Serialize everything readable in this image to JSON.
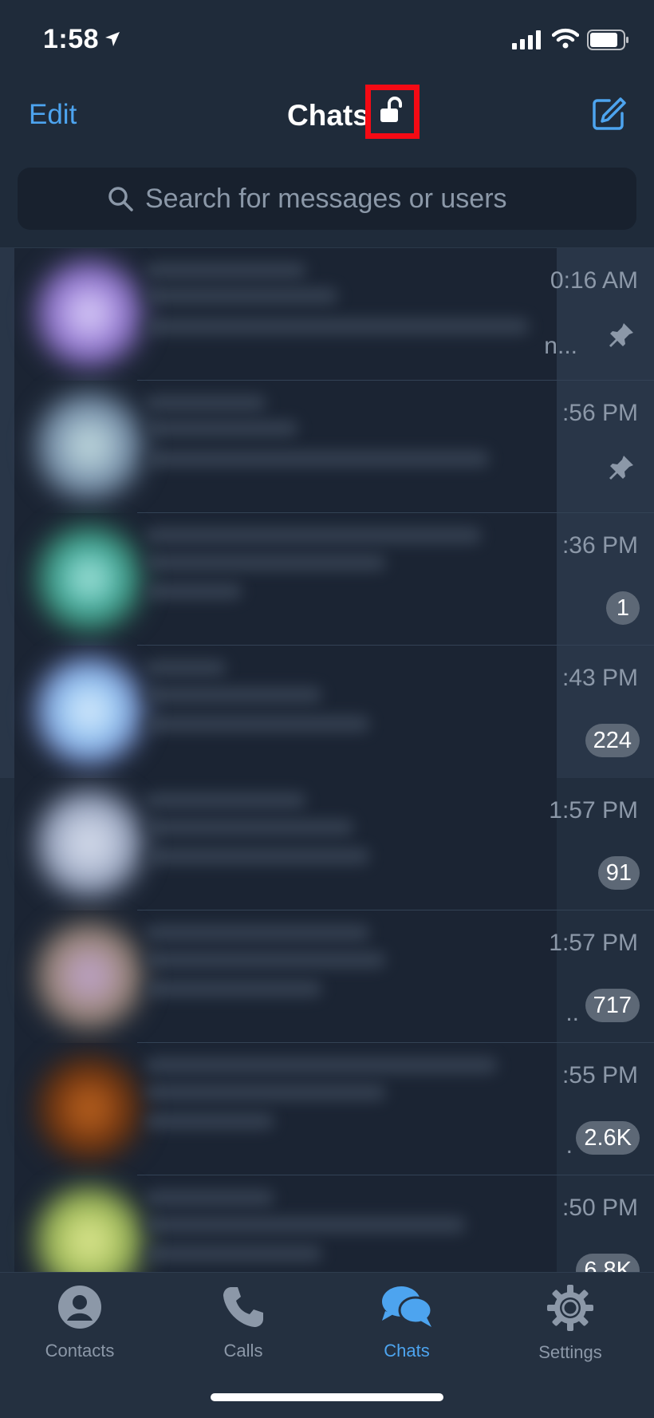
{
  "status_bar": {
    "time": "1:58",
    "icons": [
      "location-arrow-icon",
      "cellular-signal-icon",
      "wifi-icon",
      "battery-icon"
    ]
  },
  "nav": {
    "edit_label": "Edit",
    "title": "Chats",
    "lock_icon": "unlock-icon",
    "compose_icon": "compose-icon",
    "lock_highlight_color": "#f50a14"
  },
  "search": {
    "placeholder": "Search for messages or users",
    "icon": "search-icon"
  },
  "chats": [
    {
      "time": "0:16 AM",
      "preview_tail": "n...",
      "pinned": true,
      "badge": ""
    },
    {
      "time": ":56 PM",
      "preview_tail": "",
      "pinned": true,
      "badge": ""
    },
    {
      "time": ":36 PM",
      "preview_tail": "",
      "pinned": false,
      "badge": "1"
    },
    {
      "time": ":43 PM",
      "preview_tail": "",
      "pinned": false,
      "badge": "224"
    },
    {
      "time": "1:57 PM",
      "preview_tail": "",
      "pinned": false,
      "badge": "91"
    },
    {
      "time": "1:57 PM",
      "preview_tail": "..",
      "pinned": false,
      "badge": "717"
    },
    {
      "time": ":55 PM",
      "preview_tail": ".",
      "pinned": false,
      "badge": "2.6K"
    },
    {
      "time": ":50 PM",
      "preview_tail": "",
      "pinned": false,
      "badge": "6.8K"
    }
  ],
  "tabs": [
    {
      "label": "Contacts",
      "icon": "contacts-icon",
      "active": false
    },
    {
      "label": "Calls",
      "icon": "phone-icon",
      "active": false
    },
    {
      "label": "Chats",
      "icon": "chats-bubble-icon",
      "active": true
    },
    {
      "label": "Settings",
      "icon": "gear-icon",
      "active": false
    }
  ],
  "colors": {
    "accent": "#4da4ef",
    "background": "#1f2b3a",
    "pinned_row": "#293648",
    "badge": "#5d6876"
  }
}
